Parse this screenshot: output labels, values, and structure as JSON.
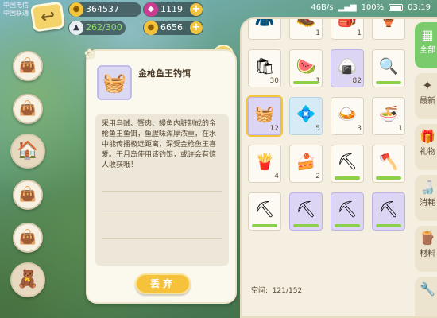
{
  "status_bar": {
    "carrier_1": "中国电信",
    "carrier_2": "中国联通",
    "net_speed": "46B/s",
    "battery": "100%",
    "time": "03:19"
  },
  "currencies": {
    "gold": "364537",
    "gems": "1119",
    "energy": "262/300",
    "coins": "6656"
  },
  "side_menu": [
    {
      "icon": "bag-icon",
      "glyph": "👜"
    },
    {
      "icon": "bag-icon",
      "glyph": "👜"
    },
    {
      "icon": "shop-icon",
      "glyph": "🏠"
    },
    {
      "icon": "bag-icon",
      "glyph": "👜"
    },
    {
      "icon": "bag-icon",
      "glyph": "👜"
    },
    {
      "icon": "bear-avatar-icon",
      "glyph": "🧸"
    }
  ],
  "detail": {
    "item_name": "金枪鱼王钓饵",
    "description": "采用乌贼、蟹肉、鳗鱼内脏制成的金枪鱼王鱼饵，鱼腥味浑厚浓重，在水中能传播极远距离，深受金枪鱼王喜爱。于月岛使用该钓饵，或许会有惊人收获哦！",
    "discard_label": "丢弃"
  },
  "inventory": {
    "space_label": "空间:",
    "space_value": "121/152",
    "items": [
      {
        "name": "outfit-icon",
        "glyph": "🧥",
        "count": "",
        "style": ""
      },
      {
        "name": "boots-icon",
        "glyph": "🥾",
        "count": "1",
        "style": ""
      },
      {
        "name": "backpack-icon",
        "glyph": "🎒",
        "count": "1",
        "style": ""
      },
      {
        "name": "trophy-icon",
        "glyph": "🏺",
        "count": "",
        "style": ""
      },
      {
        "name": "flour-sack-icon",
        "glyph": "🛍",
        "count": "30",
        "style": ""
      },
      {
        "name": "watermelon-icon",
        "glyph": "🍉",
        "count": "1",
        "style": ""
      },
      {
        "name": "rice-ball-icon",
        "glyph": "🍙",
        "count": "82",
        "style": "purple"
      },
      {
        "name": "magnifier-icon",
        "glyph": "🔍",
        "count": "",
        "style": ""
      },
      {
        "name": "tuna-bait-icon",
        "glyph": "🧺",
        "count": "12",
        "style": "purple sel"
      },
      {
        "name": "blue-gem-icon",
        "glyph": "💠",
        "count": "5",
        "style": "blue"
      },
      {
        "name": "curry-dish-icon",
        "glyph": "🍛",
        "count": "3",
        "style": ""
      },
      {
        "name": "ramen-bowl-icon",
        "glyph": "🍜",
        "count": "1",
        "style": ""
      },
      {
        "name": "fries-icon",
        "glyph": "🍟",
        "count": "4",
        "style": ""
      },
      {
        "name": "cake-plate-icon",
        "glyph": "🍰",
        "count": "2",
        "style": ""
      },
      {
        "name": "pickaxe-icon",
        "glyph": "⛏",
        "count": "",
        "style": ""
      },
      {
        "name": "axe-icon",
        "glyph": "🪓",
        "count": "",
        "style": ""
      },
      {
        "name": "pickaxe-icon",
        "glyph": "⛏",
        "count": "",
        "style": ""
      },
      {
        "name": "pickaxe-icon",
        "glyph": "⛏",
        "count": "",
        "style": "purple"
      },
      {
        "name": "pickaxe-icon",
        "glyph": "⛏",
        "count": "",
        "style": "purple"
      },
      {
        "name": "pickaxe-icon",
        "glyph": "⛏",
        "count": "",
        "style": "purple"
      }
    ]
  },
  "tabs": [
    {
      "label": "全部",
      "icon": "all-icon",
      "glyph": "▦",
      "active": true
    },
    {
      "label": "最新",
      "icon": "new-icon",
      "glyph": "✦",
      "active": false
    },
    {
      "label": "礼物",
      "icon": "gift-icon",
      "glyph": "🎁",
      "active": false
    },
    {
      "label": "消耗",
      "icon": "consumable-icon",
      "glyph": "🍶",
      "active": false
    },
    {
      "label": "材料",
      "icon": "material-icon",
      "glyph": "🪵",
      "active": false
    },
    {
      "label": "",
      "icon": "more-icon",
      "glyph": "🔧",
      "active": false
    }
  ]
}
